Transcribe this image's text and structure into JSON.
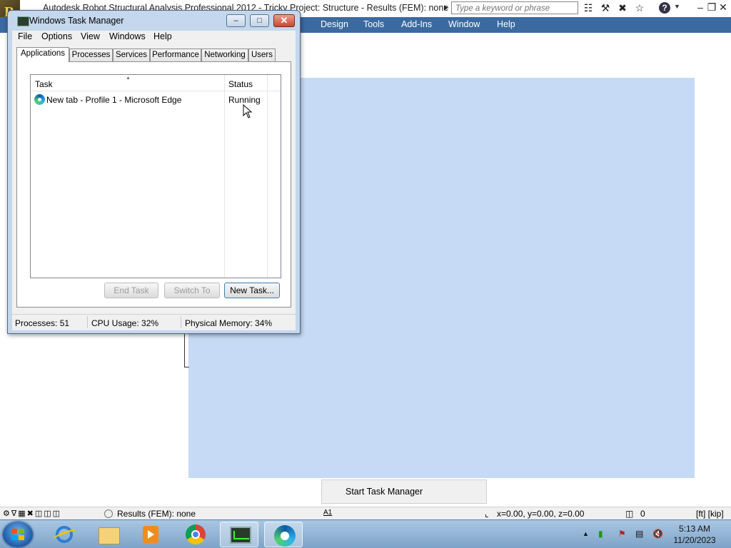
{
  "app": {
    "title": "Autodesk Robot Structural Analysis Professional 2012 - Tricky Project: Structure - Results (FEM): none",
    "search_placeholder": "Type a keyword or phrase",
    "menu": [
      "Design",
      "Tools",
      "Add-Ins",
      "Window",
      "Help"
    ],
    "toolbar_icons": [
      "binoculars-icon",
      "wrench-icon",
      "satellite-icon",
      "star-icon",
      "help-icon"
    ],
    "window_controls": [
      "minimize-icon",
      "restore-icon",
      "close-icon"
    ]
  },
  "context_menu": {
    "item": "Start Task Manager"
  },
  "robot_status": {
    "results": "Results (FEM): none",
    "coords": "x=0.00, y=0.00, z=0.00",
    "zero": "0",
    "units": "[ft] [kip]",
    "a1": "A1"
  },
  "task_manager": {
    "title": "Windows Task Manager",
    "menu": [
      "File",
      "Options",
      "View",
      "Windows",
      "Help"
    ],
    "tabs": [
      "Applications",
      "Processes",
      "Services",
      "Performance",
      "Networking",
      "Users"
    ],
    "active_tab": "Applications",
    "columns": {
      "task": "Task",
      "status": "Status"
    },
    "rows": [
      {
        "task": "New tab - Profile 1 - Microsoft Edge",
        "status": "Running",
        "icon": "edge-icon"
      }
    ],
    "buttons": {
      "end_task": "End Task",
      "switch_to": "Switch To",
      "new_task": "New Task..."
    },
    "status": {
      "processes": "Processes: 51",
      "cpu": "CPU Usage: 32%",
      "memory": "Physical Memory: 34%"
    }
  },
  "taskbar": {
    "apps": [
      "internet-explorer-icon",
      "file-explorer-icon",
      "media-player-icon",
      "chrome-icon",
      "task-manager-icon",
      "edge-icon"
    ],
    "clock": {
      "time": "5:13 AM",
      "date": "11/20/2023"
    }
  },
  "colors": {
    "robot_menubar": "#3b6aa0",
    "workspace_blue": "#c6daf5",
    "taskbar": "#8fb2d6",
    "close_button": "#c84830"
  }
}
